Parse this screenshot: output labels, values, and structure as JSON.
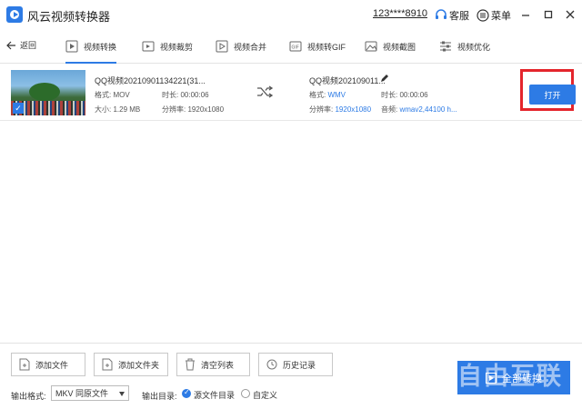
{
  "app": {
    "title": "风云视频转换器",
    "account": "123****8910",
    "service": "客服",
    "menu": "菜单"
  },
  "nav": {
    "back": "返回",
    "tabs": [
      {
        "label": "视频转换",
        "icon": "video-convert-icon",
        "active": true
      },
      {
        "label": "视频裁剪",
        "icon": "video-crop-icon"
      },
      {
        "label": "视频合并",
        "icon": "video-merge-icon"
      },
      {
        "label": "视频转GIF",
        "icon": "gif-icon"
      },
      {
        "label": "视频截图",
        "icon": "screenshot-icon"
      },
      {
        "label": "视频优化",
        "icon": "optimize-icon"
      }
    ]
  },
  "file": {
    "source": {
      "name": "QQ视频20210901134221(31...",
      "format_label": "格式:",
      "format": "MOV",
      "duration_label": "时长:",
      "duration": "00:00:06",
      "size_label": "大小:",
      "size": "1.29 MB",
      "resolution_label": "分辨率:",
      "resolution": "1920x1080"
    },
    "output": {
      "name": "QQ视频202109011...",
      "format_label": "格式:",
      "format": "WMV",
      "duration_label": "时长:",
      "duration": "00:00:06",
      "resolution_label": "分辨率:",
      "resolution": "1920x1080",
      "audio_label": "音频:",
      "audio": "wmav2,44100 h..."
    },
    "open_button": "打开"
  },
  "bottom": {
    "add_file": "添加文件",
    "add_folder": "添加文件夹",
    "clear_list": "清空列表",
    "history": "历史记录",
    "output_format_label": "输出格式:",
    "output_format_value": "MKV 同原文件",
    "output_dir_label": "输出目录:",
    "dir_source": "源文件目录",
    "dir_custom": "自定义",
    "convert_all": "全部转换",
    "watermark": "自由互联"
  },
  "colors": {
    "accent": "#2d7be5",
    "highlight": "#e4252c"
  }
}
